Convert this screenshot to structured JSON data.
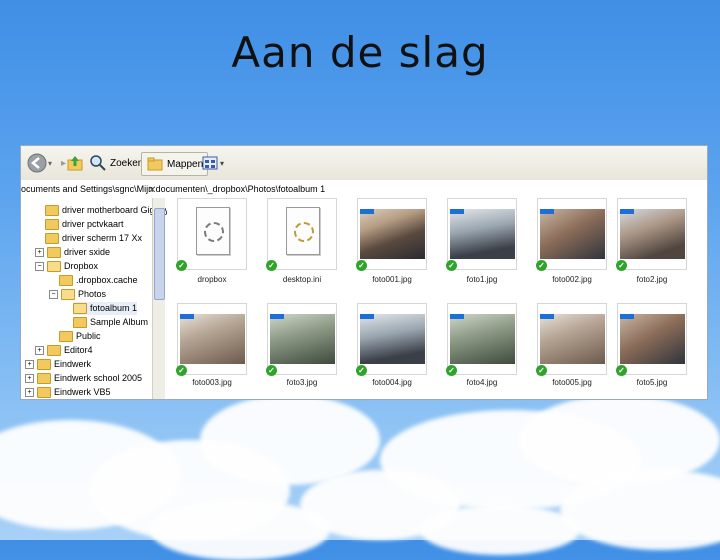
{
  "slide": {
    "title": "Aan de slag"
  },
  "toolbar": {
    "back_icon": "back-arrow-icon",
    "up_icon": "folder-up-icon",
    "search_label": "Zoeken",
    "folders_label": "Mappen",
    "views_icon": "views-icon"
  },
  "address": {
    "path": "ocuments and Settings\\sgnc\\Mijn documenten\\_dropbox\\Photos\\fotoalbum 1"
  },
  "tree": {
    "items": [
      {
        "label": "driver motherboard Gigaby"
      },
      {
        "label": "driver pctvkaart"
      },
      {
        "label": "driver scherm 17 Xx"
      },
      {
        "label": "driver sxide"
      },
      {
        "label": "Dropbox"
      },
      {
        "label": ".dropbox.cache"
      },
      {
        "label": "Photos"
      },
      {
        "label": "fotoalbum 1"
      },
      {
        "label": "Sample Album"
      },
      {
        "label": "Public"
      },
      {
        "label": "Editor4"
      },
      {
        "label": "Eindwerk"
      },
      {
        "label": "Eindwerk school 2005"
      },
      {
        "label": "Eindwerk VB5"
      }
    ]
  },
  "files": [
    {
      "name": "dropbox",
      "kind": "doc"
    },
    {
      "name": "desktop.ini",
      "kind": "ini"
    },
    {
      "name": "foto001.jpg",
      "kind": "photo"
    },
    {
      "name": "foto1.jpg",
      "kind": "photo"
    },
    {
      "name": "foto002.jpg",
      "kind": "photo"
    },
    {
      "name": "foto2.jpg",
      "kind": "photo"
    },
    {
      "name": "foto003.jpg",
      "kind": "photo"
    },
    {
      "name": "foto3.jpg",
      "kind": "photo"
    },
    {
      "name": "foto004.jpg",
      "kind": "photo"
    },
    {
      "name": "foto4.jpg",
      "kind": "photo"
    },
    {
      "name": "foto005.jpg",
      "kind": "photo"
    },
    {
      "name": "foto5.jpg",
      "kind": "photo"
    }
  ],
  "colors": {
    "sky_top": "#3f8fe6",
    "sky_bottom": "#a9d1f7",
    "sync_check": "#2ea52a"
  }
}
